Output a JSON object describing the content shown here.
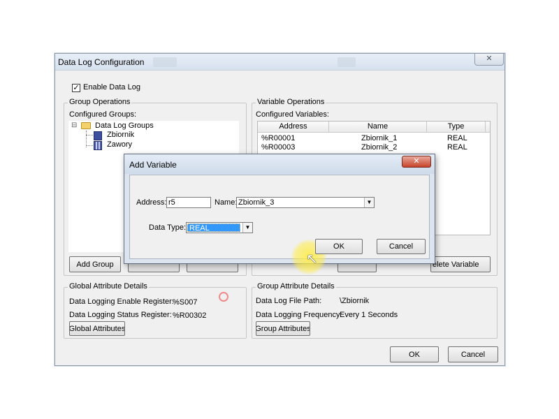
{
  "main_window": {
    "title": "Data Log Configuration",
    "close_glyph": "✕",
    "enable_checkbox": {
      "label": "Enable Data Log",
      "checked": true,
      "check_glyph": "✓"
    },
    "group_operations": {
      "legend": "Group Operations",
      "configured_label": "Configured Groups:",
      "tree": {
        "root": "Data Log Groups",
        "expander": "⊟",
        "children": [
          "Zbiornik",
          "Zawory"
        ]
      },
      "add_group_button": "Add Group"
    },
    "variable_operations": {
      "legend": "Variable Operations",
      "configured_label": "Configured Variables:",
      "columns": [
        "Address",
        "Name",
        "Type"
      ],
      "rows": [
        {
          "address": "%R00001",
          "name": "Zbiornik_1",
          "type": "REAL"
        },
        {
          "address": "%R00003",
          "name": "Zbiornik_2",
          "type": "REAL"
        }
      ],
      "delete_variable_button": "elete Variable"
    },
    "global_attribute_details": {
      "legend": "Global Attribute Details",
      "enable_register_label": "Data Logging Enable Register:",
      "enable_register_value": "%S007",
      "status_register_label": "Data Logging Status Register:",
      "status_register_value": "%R00302",
      "button": "Global Attributes"
    },
    "group_attribute_details": {
      "legend": "Group Attribute Details",
      "file_path_label": "Data Log File Path:",
      "file_path_value": "\\Zbiornik",
      "frequency_label": "Data Logging Frequency:",
      "frequency_value": "Every 1 Seconds",
      "button": "Group Attributes"
    },
    "ok_button": "OK",
    "cancel_button": "Cancel"
  },
  "add_variable_dialog": {
    "title": "Add Variable",
    "close_glyph": "✕",
    "address_label": "Address:",
    "address_value": "r5",
    "name_label": "Name:",
    "name_value": "Zbiornik_3",
    "data_type_label": "Data Type:",
    "data_type_value": "REAL",
    "dropdown_glyph": "▼",
    "ok_button": "OK",
    "cancel_button": "Cancel"
  },
  "cursor_glyph": "↖",
  "colors": {
    "selection": "#3399ff",
    "modal_close": "#c7432a",
    "cursor_highlight": "#ffec46"
  }
}
